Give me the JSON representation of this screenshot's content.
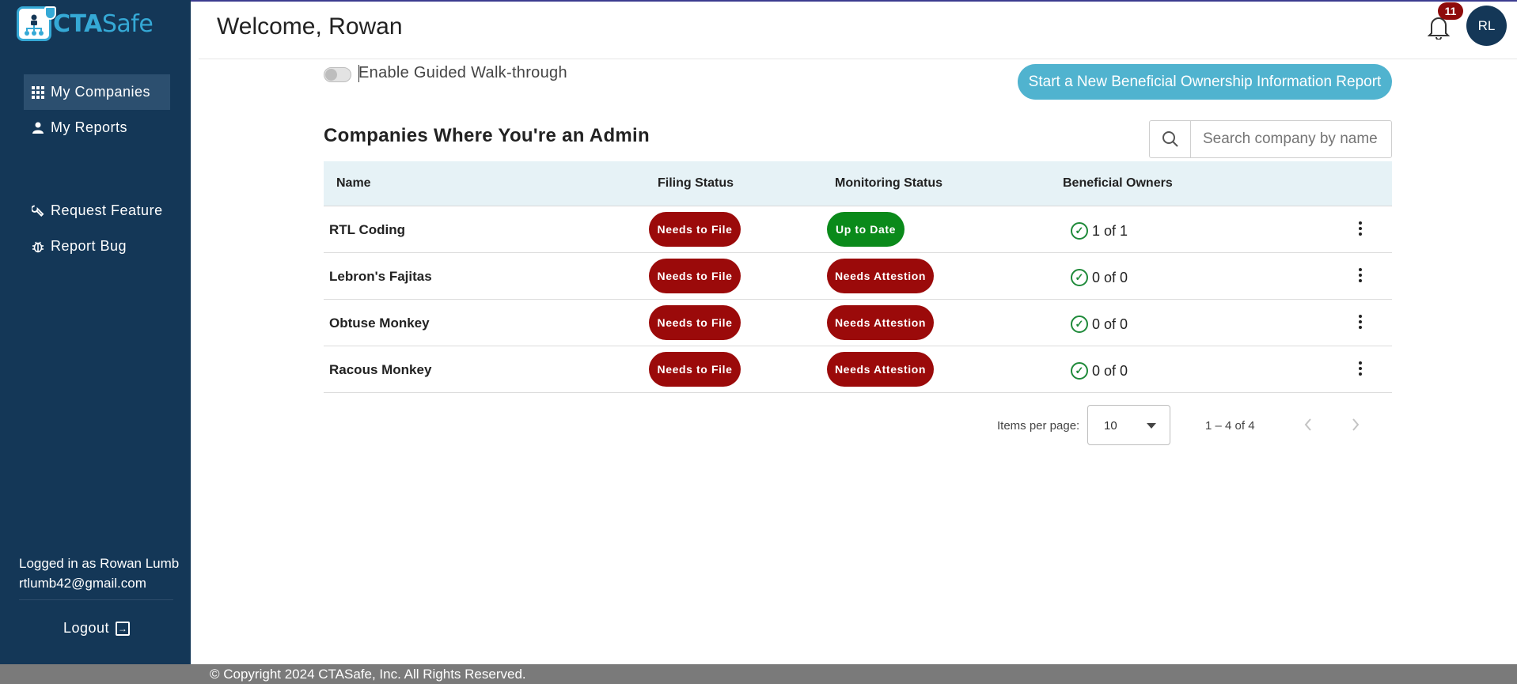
{
  "app": {
    "brand_prefix": "CTA",
    "brand_suffix": "Safe"
  },
  "sidebar": {
    "items": [
      {
        "label": "My Companies",
        "icon": "grid-icon",
        "active": true
      },
      {
        "label": "My Reports",
        "icon": "person-icon",
        "active": false
      },
      {
        "label": "Request Feature",
        "icon": "wrench-icon",
        "active": false
      },
      {
        "label": "Report Bug",
        "icon": "bug-icon",
        "active": false
      }
    ],
    "logged_in_text": "Logged in as Rowan Lumb",
    "email": "rtlumb42@gmail.com",
    "logout_label": "Logout"
  },
  "header": {
    "welcome": "Welcome, Rowan",
    "notification_count": "11",
    "avatar_initials": "RL"
  },
  "walkthrough": {
    "label": "Enable Guided Walk-through",
    "enabled": false
  },
  "actions": {
    "new_report_label": "Start a New Beneficial Ownership Information Report"
  },
  "section": {
    "title": "Companies Where You're an Admin"
  },
  "search": {
    "placeholder": "Search company by name"
  },
  "table": {
    "headers": {
      "name": "Name",
      "filing": "Filing Status",
      "monitoring": "Monitoring Status",
      "owners": "Beneficial Owners"
    },
    "rows": [
      {
        "name": "RTL Coding",
        "filing": "Needs to File",
        "monitoring": "Up to Date",
        "owners": "1 of 1"
      },
      {
        "name": "Lebron's Fajitas",
        "filing": "Needs to File",
        "monitoring": "Needs Attestion",
        "owners": "0 of 0"
      },
      {
        "name": "Obtuse Monkey",
        "filing": "Needs to File",
        "monitoring": "Needs Attestion",
        "owners": "0 of 0"
      },
      {
        "name": "Racous Monkey",
        "filing": "Needs to File",
        "monitoring": "Needs Attestion",
        "owners": "0 of 0"
      }
    ]
  },
  "paginator": {
    "items_per_page_label": "Items per page:",
    "page_size": "10",
    "range": "1 – 4 of 4"
  },
  "footer": {
    "copyright": "© Copyright 2024 CTASafe, Inc. All Rights Reserved."
  },
  "colors": {
    "sidebar_bg": "#143757",
    "accent": "#50b3cf",
    "status_red": "#9b0a0a",
    "status_green": "#0a8a1a"
  }
}
